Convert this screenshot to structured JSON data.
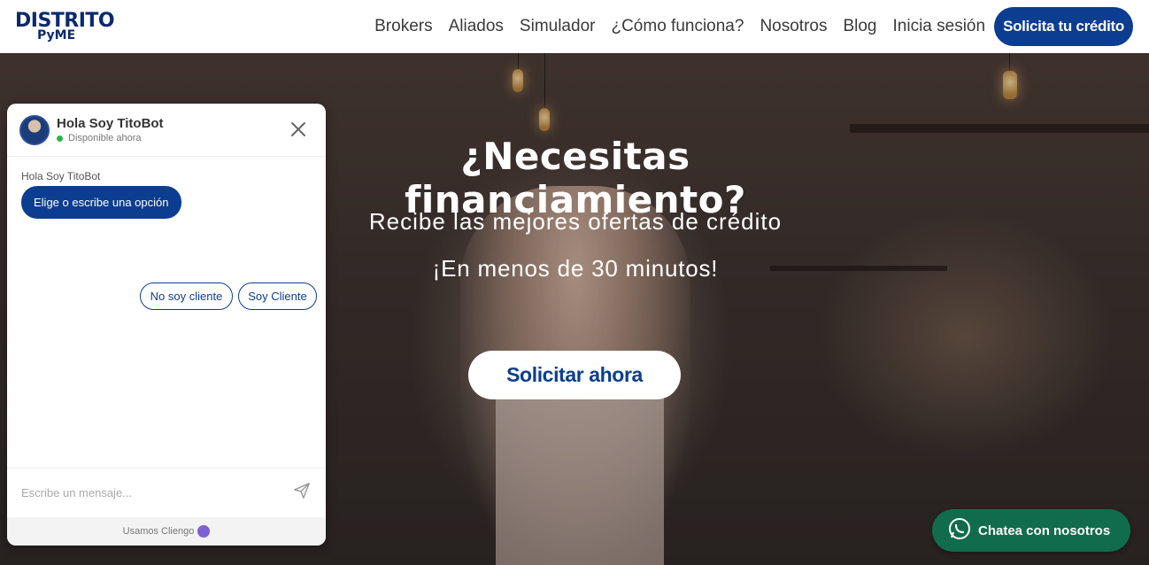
{
  "header": {
    "logo_top": "DISTRITO",
    "logo_bottom": "PyME",
    "nav": [
      "Brokers",
      "Aliados",
      "Simulador",
      "¿Cómo funciona?",
      "Nosotros",
      "Blog",
      "Inicia sesión"
    ],
    "cta": "Solicita tu crédito"
  },
  "hero": {
    "title": "¿Necesitas financiamiento?",
    "subtitle": "Recibe las mejores ofertas de crédito",
    "subtitle2": "¡En menos de 30 minutos!",
    "button": "Solicitar ahora"
  },
  "chat": {
    "bot_name": "Hola Soy TitoBot",
    "status": "Disponible ahora",
    "message_label": "Hola Soy TitoBot",
    "message": "Elige o escribe una opción",
    "options": [
      "No soy cliente",
      "Soy Cliente"
    ],
    "input_placeholder": "Escribe un mensaje...",
    "footer": "Usamos Cliengo"
  },
  "whatsapp": {
    "label": "Chatea con nosotros"
  },
  "colors": {
    "brand": "#0b3d91",
    "whatsapp": "#116c4d"
  }
}
